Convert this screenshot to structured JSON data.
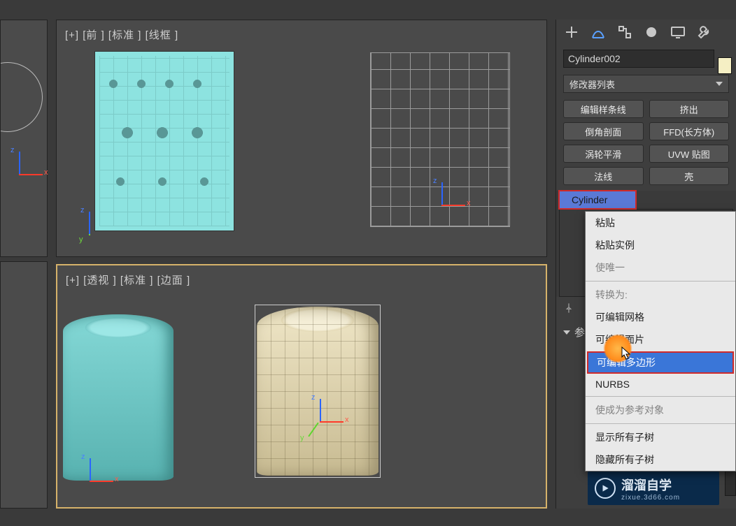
{
  "viewports": {
    "front_label": "[+] [前 ] [标准 ] [线框 ]",
    "persp_label": "[+] [透视 ] [标准 ] [边面 ]"
  },
  "panel": {
    "object_name": "Cylinder002",
    "modifier_dropdown": "修改器列表",
    "buttons": {
      "b0": "编辑样条线",
      "b1": "挤出",
      "b2": "倒角剖面",
      "b3": "FFD(长方体)",
      "b4": "涡轮平滑",
      "b5": "UVW 贴图",
      "b6": "法线",
      "b7": "壳"
    },
    "stack_item": "Cylinder",
    "param_header": "参"
  },
  "context_menu": {
    "paste": "粘贴",
    "paste_instance": "粘贴实例",
    "make_unique": "使唯一",
    "convert_to": "转换为:",
    "editable_mesh": "可编辑网格",
    "editable_patch": "可编辑面片",
    "editable_poly": "可编辑多边形",
    "nurbs": "NURBS",
    "make_reference": "使成为参考对象",
    "show_all_subtrees": "显示所有子树",
    "hide_all_subtrees": "隐藏所有子树"
  },
  "watermark": {
    "title": "溜溜自学",
    "sub": "zixue.3d66.com"
  },
  "axes": {
    "x": "x",
    "y": "y",
    "z": "z"
  }
}
